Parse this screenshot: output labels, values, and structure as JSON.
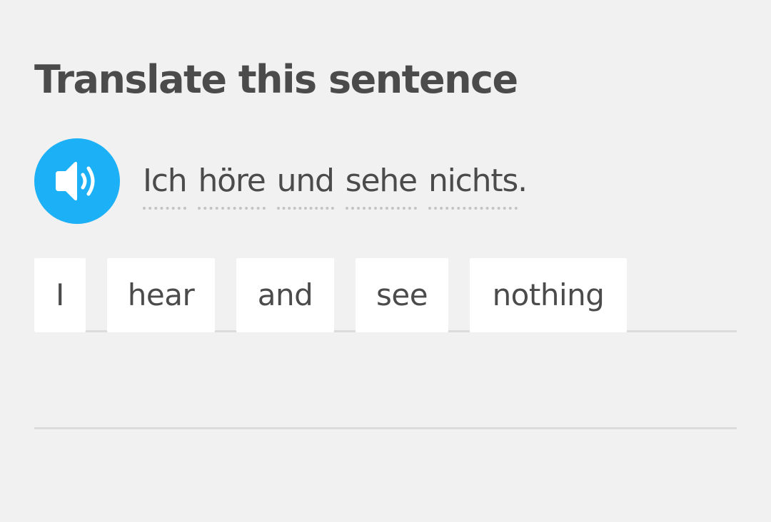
{
  "title": "Translate this sentence",
  "audio_button": {
    "icon": "speaker-icon",
    "color": "#1cb0f6"
  },
  "sentence": {
    "words": [
      "Ich",
      "höre",
      "und",
      "sehe",
      "nichts"
    ],
    "punctuation": "."
  },
  "answer_tiles": [
    "I",
    "hear",
    "and",
    "see",
    "nothing"
  ]
}
